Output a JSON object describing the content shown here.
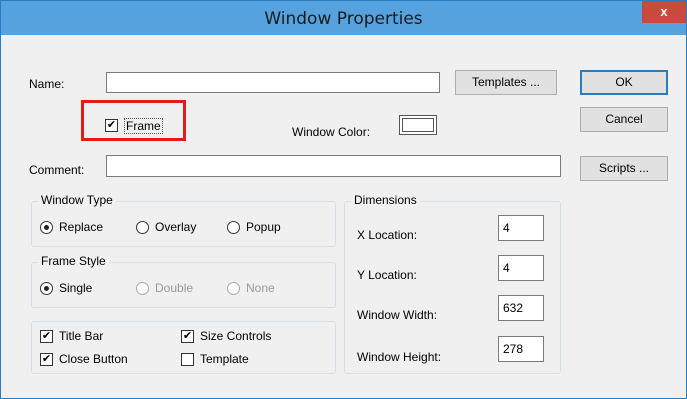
{
  "window": {
    "title": "Window Properties",
    "close_glyph": "x"
  },
  "fields": {
    "name_label": "Name:",
    "name_value": "",
    "comment_label": "Comment:",
    "comment_value": "",
    "window_color_label": "Window Color:",
    "window_color_value": "#ffffff"
  },
  "buttons": {
    "templates": "Templates ...",
    "ok": "OK",
    "cancel": "Cancel",
    "scripts": "Scripts ..."
  },
  "frame_checkbox": {
    "label": "Frame",
    "checked": true
  },
  "window_type": {
    "title": "Window Type",
    "options": [
      {
        "label": "Replace",
        "checked": true,
        "disabled": false
      },
      {
        "label": "Overlay",
        "checked": false,
        "disabled": false
      },
      {
        "label": "Popup",
        "checked": false,
        "disabled": false
      }
    ]
  },
  "frame_style": {
    "title": "Frame Style",
    "options": [
      {
        "label": "Single",
        "checked": true,
        "disabled": false
      },
      {
        "label": "Double",
        "checked": false,
        "disabled": true
      },
      {
        "label": "None",
        "checked": false,
        "disabled": true
      }
    ]
  },
  "checkboxes": [
    {
      "label": "Title Bar",
      "checked": true
    },
    {
      "label": "Size Controls",
      "checked": true
    },
    {
      "label": "Close Button",
      "checked": true
    },
    {
      "label": "Template",
      "checked": false
    }
  ],
  "dimensions": {
    "title": "Dimensions",
    "fields": [
      {
        "label": "X Location:",
        "value": "4"
      },
      {
        "label": "Y Location:",
        "value": "4"
      },
      {
        "label": "Window Width:",
        "value": "632"
      },
      {
        "label": "Window Height:",
        "value": "278"
      }
    ]
  },
  "highlight_color": "#e31b1b"
}
